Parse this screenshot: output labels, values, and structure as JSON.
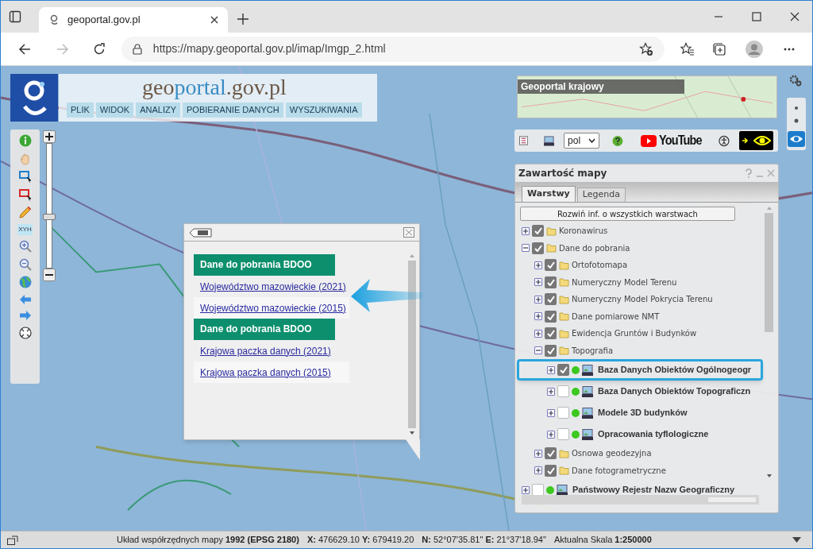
{
  "browser": {
    "tab_title": "geoportal.gov.pl",
    "url": "https://mapy.geoportal.gov.pl/imap/Imgp_2.html"
  },
  "header": {
    "logo_parts": [
      {
        "text": "geo",
        "color": "#6b5846"
      },
      {
        "text": "portal",
        "color": "#3a8cc4"
      },
      {
        "text": ".gov.pl",
        "color": "#6b5846"
      }
    ],
    "menu": [
      "PLIK",
      "WIDOK",
      "ANALIZY",
      "POBIERANIE DANYCH",
      "WYSZUKIWANIA"
    ]
  },
  "overview_map": {
    "title": "Geoportal krajowy"
  },
  "left_toolbar": {
    "coordinates_label": "XYH"
  },
  "zoom_slider": {
    "level": 0.39
  },
  "top_toolbar": {
    "language": "pol",
    "youtube": "YouTube"
  },
  "popup": {
    "groups": [
      {
        "title": "Dane do pobrania BDOO",
        "links": [
          "Województwo mazowieckie (2021)",
          "Województwo mazowieckie (2015)"
        ]
      },
      {
        "title": "Dane do pobrania BDOO",
        "links": [
          "Krajowa paczka danych (2021)",
          "Krajowa paczka danych (2015)"
        ]
      }
    ]
  },
  "layers_panel": {
    "title": "Zawartość mapy",
    "tabs": [
      {
        "label": "Warstwy",
        "selected": true
      },
      {
        "label": "Legenda",
        "selected": false
      }
    ],
    "expand_button": "Rozwiń inf. o wszystkich warstwach",
    "tree": [
      {
        "kind": "folder",
        "label": "Koronawirus",
        "checked": true,
        "expanded": false,
        "selected": false
      },
      {
        "kind": "folder",
        "label": "Dane do pobrania",
        "checked": true,
        "expanded": true,
        "selected": false,
        "children": [
          {
            "kind": "folder",
            "label": "Ortofotomapa",
            "checked": true,
            "expanded": false,
            "selected": false
          },
          {
            "kind": "folder",
            "label": "Numeryczny Model Terenu",
            "checked": true,
            "expanded": false,
            "selected": false
          },
          {
            "kind": "folder",
            "label": "Numeryczny Model Pokrycia Terenu",
            "checked": true,
            "expanded": false,
            "selected": false
          },
          {
            "kind": "folder",
            "label": "Dane pomiarowe NMT",
            "checked": true,
            "expanded": false,
            "selected": false
          },
          {
            "kind": "folder",
            "label": "Ewidencja Gruntów i Budynków",
            "checked": true,
            "expanded": false,
            "selected": false
          },
          {
            "kind": "folder",
            "label": "Topografia",
            "checked": true,
            "expanded": true,
            "selected": false,
            "children": [
              {
                "kind": "wms",
                "label": "Baza Danych Obiektów Ogólnogeogr",
                "checked": true,
                "expanded": false,
                "selected": true
              },
              {
                "kind": "wms",
                "label": "Baza Danych Obiektów Topograficzn",
                "checked": false,
                "expanded": false,
                "selected": false
              },
              {
                "kind": "wms",
                "label": "Modele 3D budynków",
                "checked": false,
                "expanded": false,
                "selected": false
              },
              {
                "kind": "wms",
                "label": "Opracowania tyflologiczne",
                "checked": false,
                "expanded": false,
                "selected": false
              }
            ]
          },
          {
            "kind": "folder",
            "label": "Osnowa geodezyjna",
            "checked": true,
            "expanded": false,
            "selected": false
          },
          {
            "kind": "folder",
            "label": "Dane fotogrametryczne",
            "checked": true,
            "expanded": false,
            "selected": false
          }
        ]
      },
      {
        "kind": "wms",
        "label": "Państwowy Rejestr Nazw Geograficzny",
        "checked": false,
        "expanded": false,
        "selected": false
      }
    ]
  },
  "status_bar": {
    "items": [
      "Układ współrzędnych mapy **1992 (EPSG 2180)**",
      "**X:** 476629.10 **Y:** 679419.20",
      "**N:** 52°07'35.81\" **E:** 21°37'18.94\"",
      "Aktualna Skala **1:250000**"
    ]
  }
}
